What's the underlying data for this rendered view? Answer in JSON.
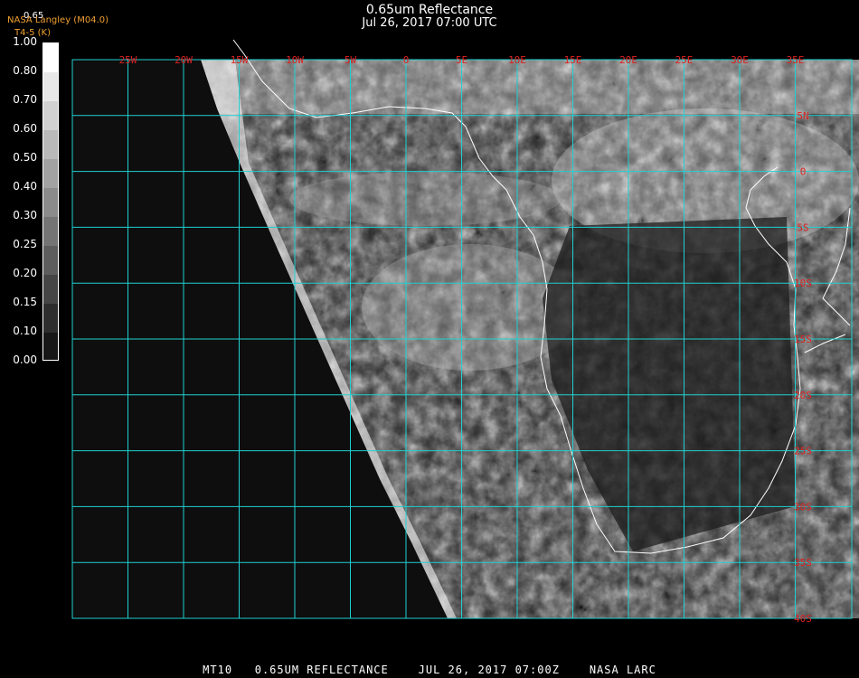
{
  "title": "0.65um Reflectance",
  "subtitle_date": "Jul 26, 2017 07:00 UTC",
  "producer": "NASA Langley (M04.0)",
  "legend": {
    "title": "0.65",
    "subtitle": "T4-5 (K)",
    "labels": [
      "1.00",
      "0.80",
      "0.70",
      "0.60",
      "0.50",
      "0.40",
      "0.30",
      "0.25",
      "0.20",
      "0.15",
      "0.10",
      "0.00"
    ]
  },
  "map": {
    "lon_labels": [
      "25W",
      "20W",
      "15W",
      "10W",
      "5W",
      "0",
      "5E",
      "10E",
      "15E",
      "20E",
      "25E",
      "30E",
      "35E"
    ],
    "lat_labels": [
      "5N",
      "0",
      "5S",
      "10S",
      "15S",
      "20S",
      "25S",
      "30S",
      "35S",
      "40S"
    ],
    "grid_color": "#20d0d0",
    "label_color": "#e02020",
    "coast_color": "#ffffff"
  },
  "footer": "MT10   0.65UM REFLECTANCE    JUL 26, 2017 07:00Z    NASA LARC"
}
